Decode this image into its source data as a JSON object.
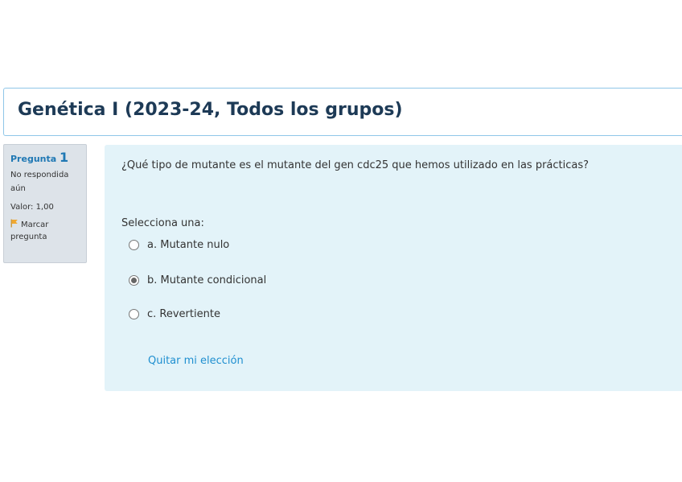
{
  "course": {
    "title": "Genética I (2023-24, Todos los grupos)"
  },
  "question_info": {
    "label": "Pregunta",
    "number": "1",
    "status": "No respondida aún",
    "grade": "Valor: 1,00",
    "flag_label": "Marcar pregunta",
    "flag_icon": "flag-icon"
  },
  "question": {
    "text": "¿Qué tipo de mutante es el mutante del gen cdc25 que hemos utilizado en las prácticas?",
    "prompt": "Selecciona una:",
    "options": [
      {
        "label": "a. Mutante nulo",
        "selected": false
      },
      {
        "label": "b. Mutante condicional",
        "selected": true
      },
      {
        "label": "c. Revertiente",
        "selected": false
      }
    ],
    "clear_label": "Quitar mi elección"
  },
  "colors": {
    "title": "#1d3a56",
    "accent_blue": "#1f78b4",
    "link": "#1f8fd0",
    "content_bg": "#e3f3f9",
    "info_bg": "#dde3e9",
    "header_border": "#8fc6e8",
    "flag": "#f0a830"
  }
}
